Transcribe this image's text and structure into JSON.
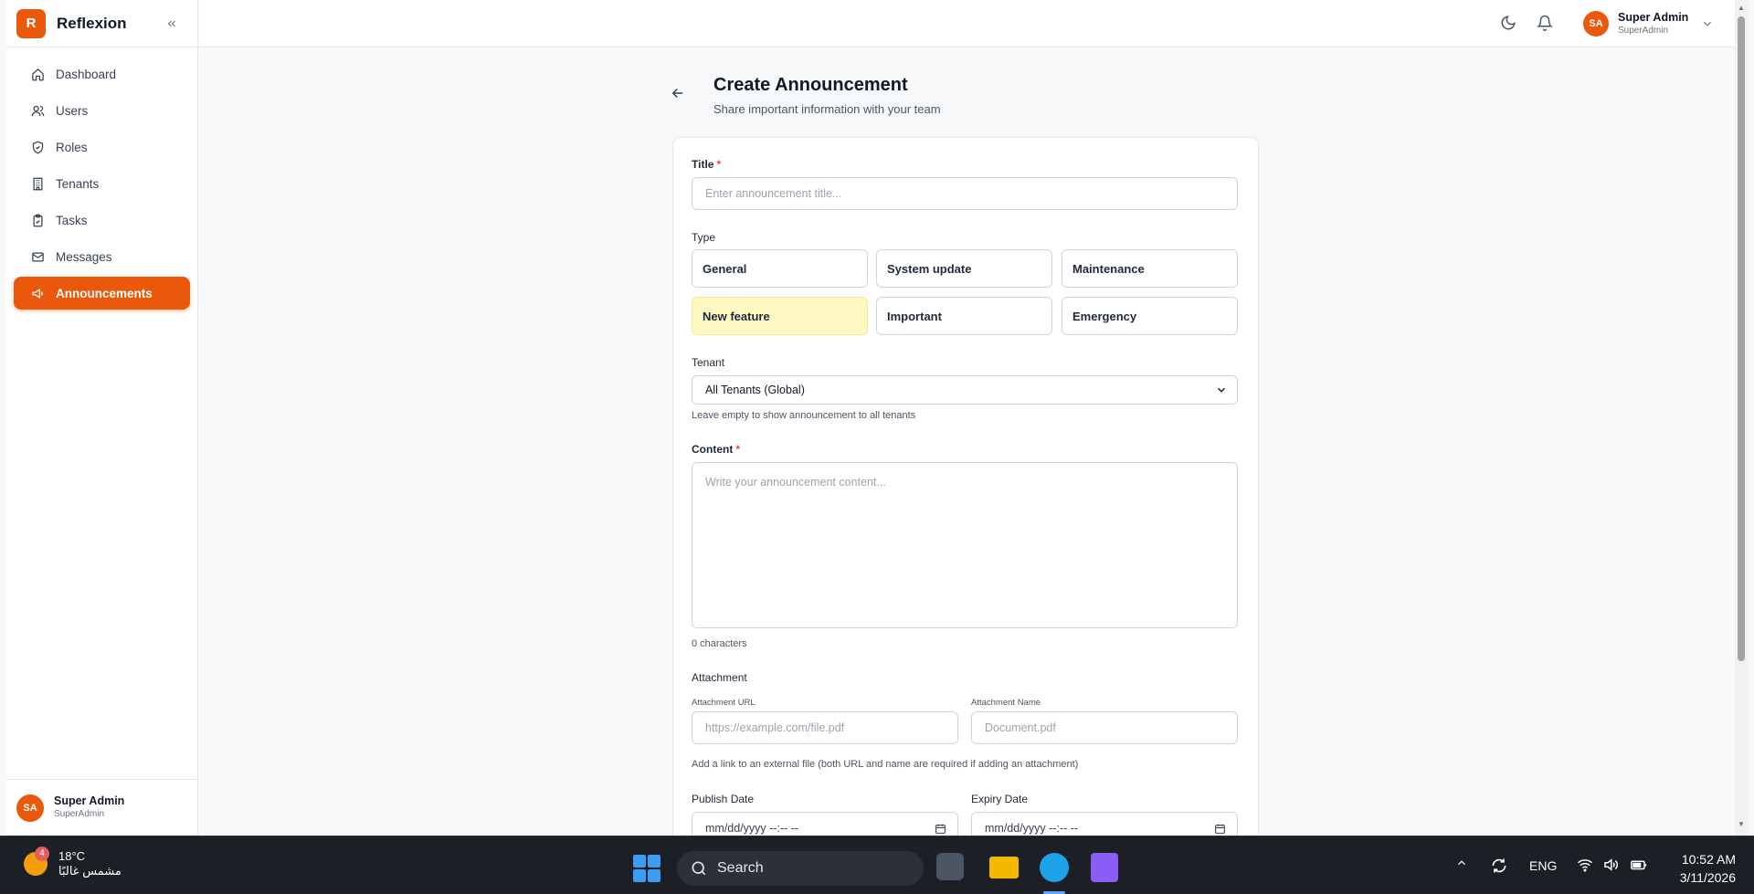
{
  "app": {
    "brand_letter": "R",
    "brand_name": "Reflexion"
  },
  "sidebar": {
    "items": [
      {
        "label": "Dashboard",
        "icon": "home-icon"
      },
      {
        "label": "Users",
        "icon": "users-icon"
      },
      {
        "label": "Roles",
        "icon": "shield-icon"
      },
      {
        "label": "Tenants",
        "icon": "building-icon"
      },
      {
        "label": "Tasks",
        "icon": "clipboard-icon"
      },
      {
        "label": "Messages",
        "icon": "mail-icon"
      },
      {
        "label": "Announcements",
        "icon": "megaphone-icon",
        "active": true
      }
    ],
    "user": {
      "initials": "SA",
      "name": "Super Admin",
      "role": "SuperAdmin"
    }
  },
  "header": {
    "user": {
      "initials": "SA",
      "name": "Super Admin",
      "role": "SuperAdmin"
    }
  },
  "page": {
    "title": "Create Announcement",
    "subtitle": "Share important information with your team"
  },
  "form": {
    "title_label": "Title",
    "title_required": "*",
    "title_placeholder": "Enter announcement title...",
    "type_label": "Type",
    "types": [
      "General",
      "System update",
      "Maintenance",
      "New feature",
      "Important",
      "Emergency"
    ],
    "selected_type": "New feature",
    "tenant_label": "Tenant",
    "tenant_value": "All Tenants (Global)",
    "tenant_help": "Leave empty to show announcement to all tenants",
    "content_label": "Content",
    "content_required": "*",
    "content_placeholder": "Write your announcement content...",
    "char_count": "0 characters",
    "attachment_label": "Attachment",
    "attachment_url_label": "Attachment URL",
    "attachment_url_placeholder": "https://example.com/file.pdf",
    "attachment_name_label": "Attachment Name",
    "attachment_name_placeholder": "Document.pdf",
    "attachment_help": "Add a link to an external file (both URL and name are required if adding an attachment)",
    "publish_label": "Publish Date",
    "publish_value": "mm/dd/yyyy --:-- --",
    "expiry_label": "Expiry Date",
    "expiry_value": "mm/dd/yyyy --:-- --"
  },
  "taskbar": {
    "weather_badge": "4",
    "temperature": "18°C",
    "weather_desc": "مشمس غالبًا",
    "search_label": "Search",
    "lang": "ENG",
    "time": "10:52 AM",
    "date": "3/11/2026"
  },
  "colors": {
    "accent": "#ea580c",
    "selected_type_bg": "#fef9c3",
    "required": "#ef4444"
  }
}
